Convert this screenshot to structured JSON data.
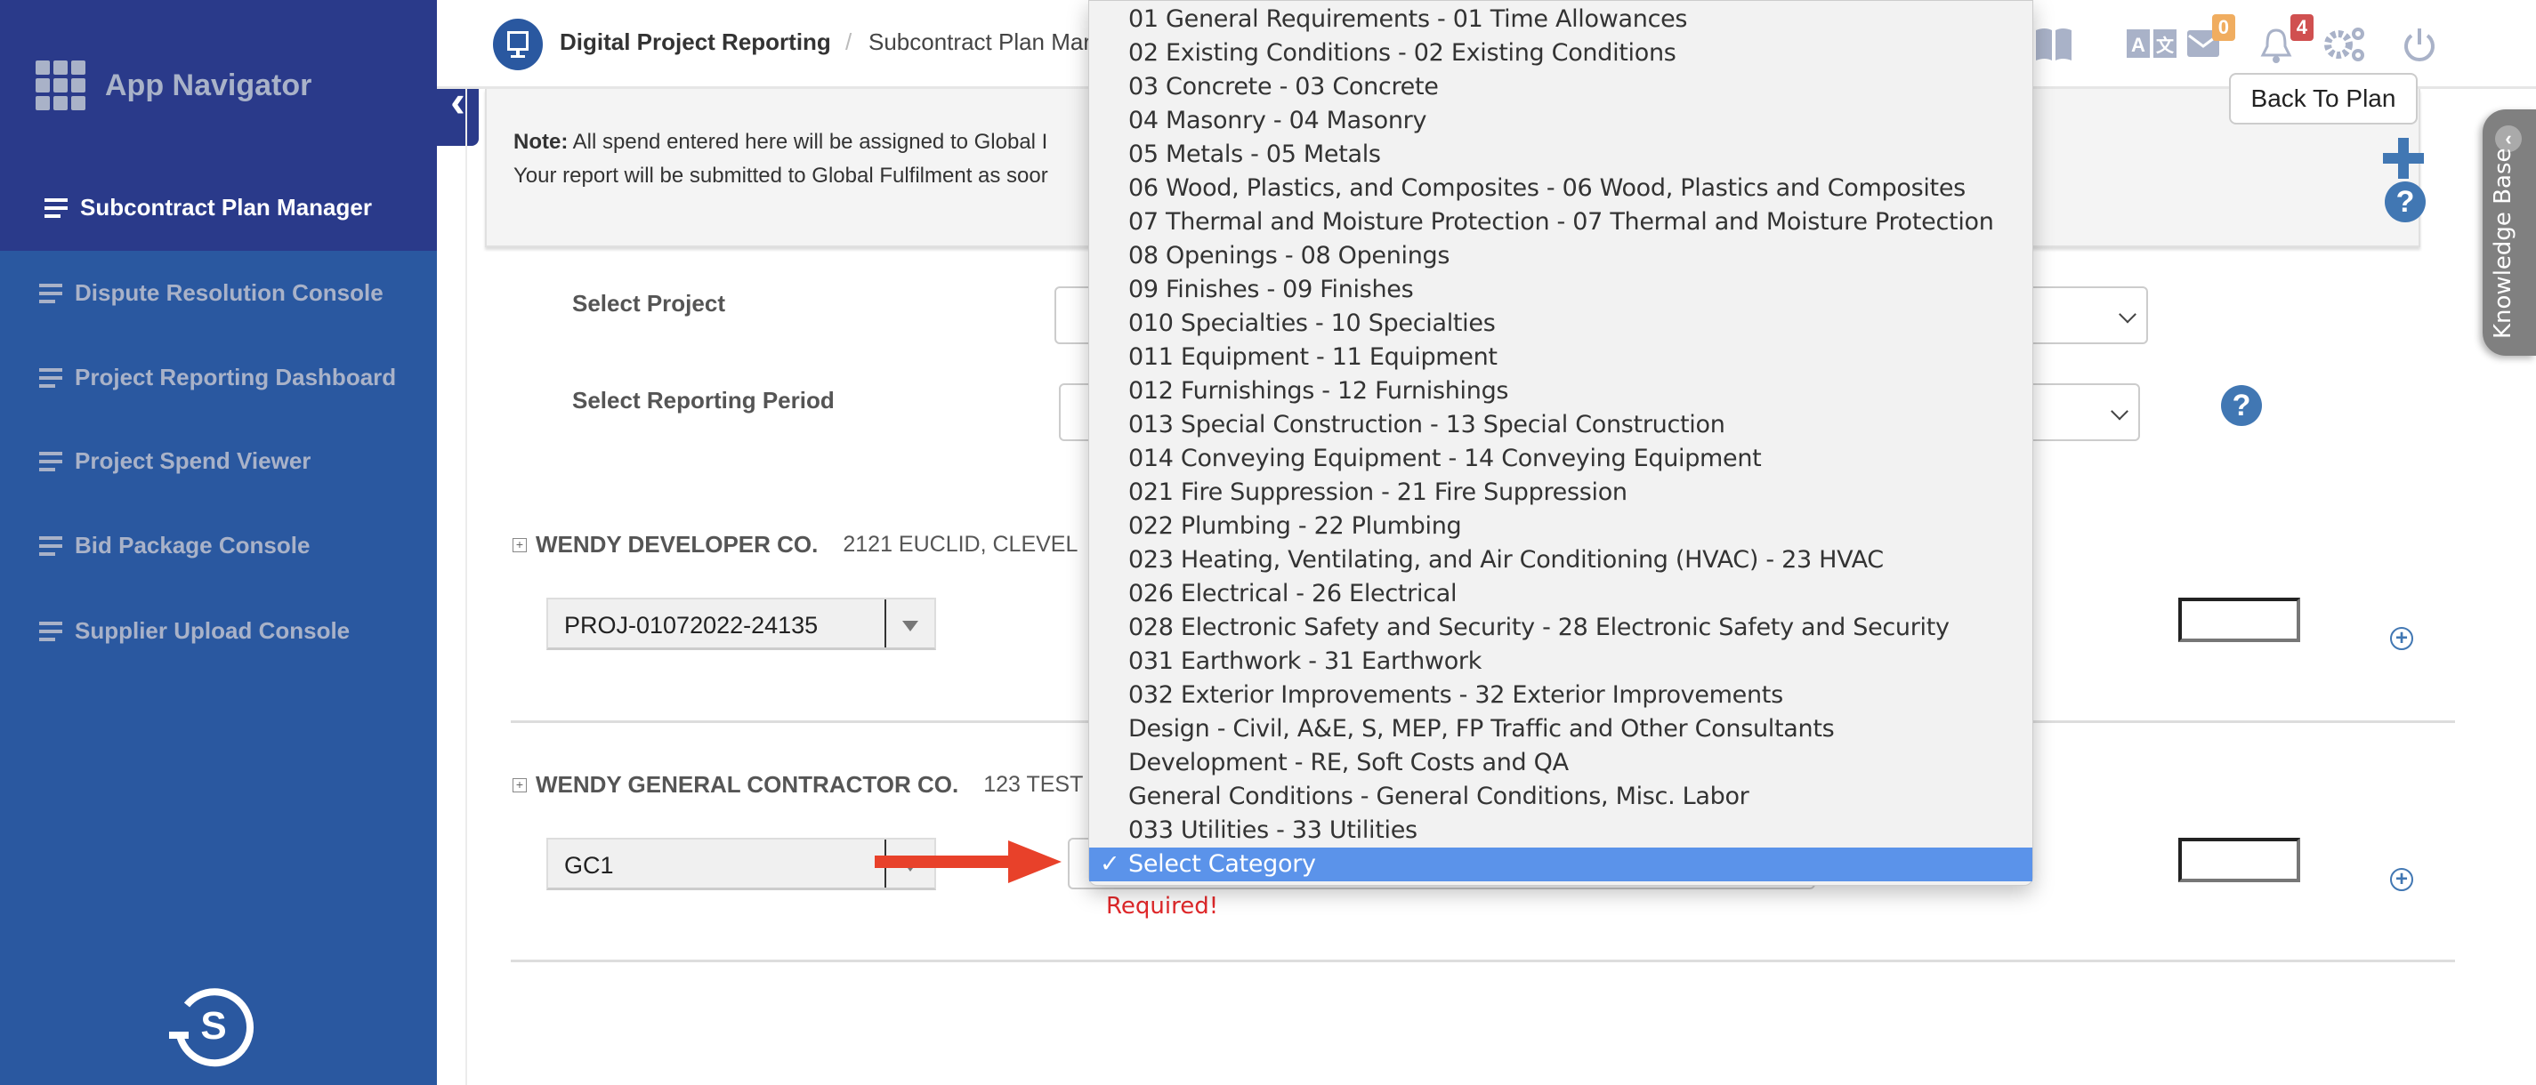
{
  "sidebar": {
    "title": "App Navigator",
    "active_item": "Subcontract Plan Manager",
    "items": [
      "Dispute Resolution Console",
      "Project Reporting Dashboard",
      "Project Spend Viewer",
      "Bid Package Console",
      "Supplier Upload Console"
    ]
  },
  "header": {
    "app": "Digital Project Reporting",
    "separator": "/",
    "breadcrumb": "Subcontract Plan Mar",
    "mail_count": "0",
    "notification_count": "4"
  },
  "note": {
    "label": "Note:",
    "line1": "All spend entered here will be assigned to Global I",
    "line2": "Your report will be submitted to Global Fulfilment as soor"
  },
  "back_button": "Back To Plan",
  "knowledge_base": "Knowledge Base",
  "form": {
    "project_label": "Select Project",
    "period_label": "Select Reporting Period"
  },
  "companies": [
    {
      "name": "WENDY DEVELOPER CO.",
      "address": "2121 EUCLID, CLEVEL",
      "combo_value": "PROJ-01072022-24135"
    },
    {
      "name": "WENDY GENERAL CONTRACTOR CO.",
      "address": "123 TEST",
      "combo_value": "GC1"
    }
  ],
  "dropdown": {
    "options": [
      "01 General Requirements - 01 Time Allowances",
      "02 Existing Conditions - 02 Existing Conditions",
      "03 Concrete - 03 Concrete",
      "04 Masonry - 04 Masonry",
      "05 Metals - 05 Metals",
      "06 Wood, Plastics, and Composites - 06 Wood, Plastics and Composites",
      "07 Thermal and Moisture Protection - 07 Thermal and Moisture Protection",
      "08 Openings - 08 Openings",
      "09 Finishes - 09 Finishes",
      "010 Specialties - 10 Specialties",
      "011 Equipment - 11 Equipment",
      "012 Furnishings - 12 Furnishings",
      "013 Special Construction - 13 Special Construction",
      "014 Conveying Equipment - 14 Conveying Equipment",
      "021 Fire Suppression - 21 Fire Suppression",
      "022 Plumbing - 22 Plumbing",
      "023 Heating, Ventilating, and Air Conditioning (HVAC) - 23 HVAC",
      "026 Electrical - 26 Electrical",
      "028 Electronic Safety and Security - 28 Electronic Safety and Security",
      "031 Earthwork - 31 Earthwork",
      "032 Exterior Improvements - 32 Exterior Improvements",
      "Design - Civil, A&E, S, MEP, FP Traffic and Other Consultants",
      "Development - RE, Soft Costs and QA",
      "General Conditions - General Conditions, Misc. Labor",
      "033 Utilities - 33 Utilities"
    ],
    "selected": "Select Category",
    "check": "✓"
  },
  "validation": "Required!",
  "colors": {
    "sidebar_top": "#2a3a8a",
    "sidebar": "#2a58a0",
    "accent": "#4177b3",
    "selected_option": "#5b93ea",
    "required": "#e0282a",
    "mail_badge": "#f0ad60",
    "bell_badge": "#d05050",
    "arrow": "#e8412a"
  }
}
